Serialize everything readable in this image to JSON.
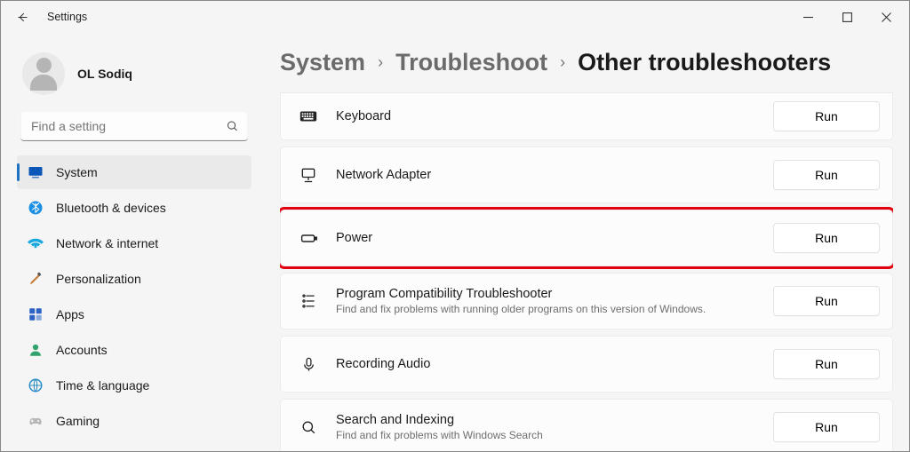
{
  "window": {
    "title": "Settings"
  },
  "user": {
    "name": "OL Sodiq"
  },
  "search": {
    "placeholder": "Find a setting"
  },
  "sidebar": {
    "items": [
      {
        "label": "System",
        "active": true
      },
      {
        "label": "Bluetooth & devices"
      },
      {
        "label": "Network & internet"
      },
      {
        "label": "Personalization"
      },
      {
        "label": "Apps"
      },
      {
        "label": "Accounts"
      },
      {
        "label": "Time & language"
      },
      {
        "label": "Gaming"
      }
    ]
  },
  "breadcrumbs": {
    "a": "System",
    "b": "Troubleshoot",
    "c": "Other troubleshooters"
  },
  "rows": [
    {
      "title": "Keyboard",
      "run": "Run"
    },
    {
      "title": "Network Adapter",
      "run": "Run"
    },
    {
      "title": "Power",
      "run": "Run"
    },
    {
      "title": "Program Compatibility Troubleshooter",
      "sub": "Find and fix problems with running older programs on this version of Windows.",
      "run": "Run"
    },
    {
      "title": "Recording Audio",
      "run": "Run"
    },
    {
      "title": "Search and Indexing",
      "sub": "Find and fix problems with Windows Search",
      "run": "Run"
    }
  ]
}
